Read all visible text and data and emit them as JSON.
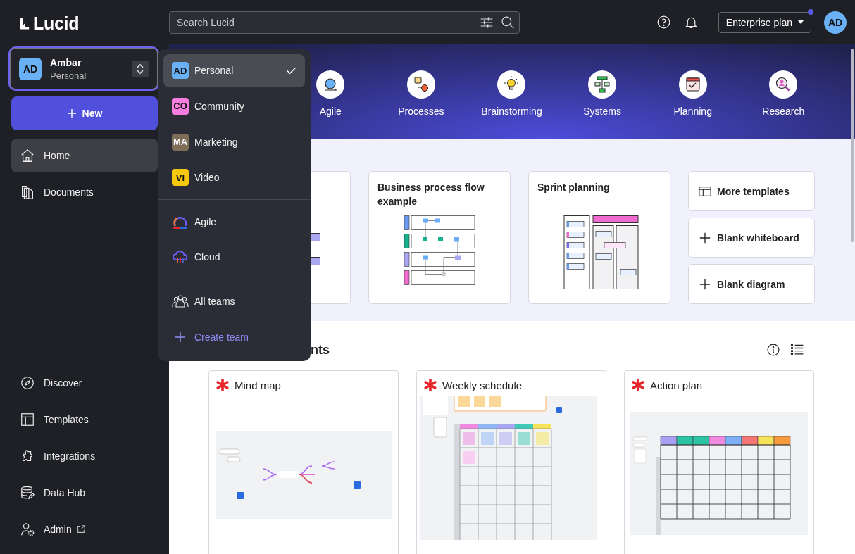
{
  "logo": {
    "text": "Lucid"
  },
  "search": {
    "placeholder": "Search Lucid"
  },
  "topbar": {
    "plan": "Enterprise plan",
    "plan_notification": true,
    "avatar": "AD"
  },
  "account": {
    "initials": "AD",
    "name": "Ambar",
    "workspace": "Personal"
  },
  "new_button": {
    "label": "New"
  },
  "sidebar": {
    "items": [
      {
        "label": "Home",
        "kind": "home",
        "selected": true
      },
      {
        "label": "Documents",
        "kind": "documents",
        "selected": false
      }
    ],
    "bottom_items": [
      {
        "label": "Discover",
        "kind": "compass",
        "external": false
      },
      {
        "label": "Templates",
        "kind": "templates",
        "external": false
      },
      {
        "label": "Integrations",
        "kind": "puzzle",
        "external": false
      },
      {
        "label": "Data Hub",
        "kind": "database",
        "external": false
      },
      {
        "label": "Admin",
        "kind": "admin",
        "external": true
      }
    ]
  },
  "team_menu": {
    "teams": [
      {
        "initials": "AD",
        "label": "Personal",
        "color": "#6ab0f5",
        "selected": true
      },
      {
        "initials": "CO",
        "label": "Community",
        "color": "#f77ee0",
        "selected": false
      },
      {
        "initials": "MA",
        "label": "Marketing",
        "color": "#7e6e57",
        "selected": false
      },
      {
        "initials": "VI",
        "label": "Video",
        "color": "#f7c90e",
        "selected": false
      }
    ],
    "apps": [
      {
        "label": "Agile",
        "kind": "agile"
      },
      {
        "label": "Cloud",
        "kind": "cloud"
      }
    ],
    "all_teams": "All teams",
    "create_team": "Create team"
  },
  "hero": {
    "categories": [
      {
        "label": "Agile",
        "kind": "agile"
      },
      {
        "label": "Processes",
        "kind": "processes"
      },
      {
        "label": "Brainstorming",
        "kind": "brainstorming"
      },
      {
        "label": "Systems",
        "kind": "systems"
      },
      {
        "label": "Planning",
        "kind": "planning"
      },
      {
        "label": "Research",
        "kind": "research"
      }
    ]
  },
  "templates": {
    "cards": [
      {
        "kind": "bars"
      },
      {
        "title": "Business process flow example",
        "kind": "flow"
      },
      {
        "title": "Sprint planning",
        "kind": "sprint"
      }
    ],
    "actions": [
      {
        "label": "More templates",
        "kind": "grid"
      },
      {
        "label": "Blank whiteboard",
        "kind": "plus"
      },
      {
        "label": "Blank diagram",
        "kind": "plus"
      }
    ]
  },
  "recent": {
    "heading": "nts",
    "documents": [
      {
        "title": "Mind map",
        "kind": "mindmap"
      },
      {
        "title": "Weekly schedule",
        "kind": "schedule"
      },
      {
        "title": "Action plan",
        "kind": "actionplan"
      }
    ]
  }
}
